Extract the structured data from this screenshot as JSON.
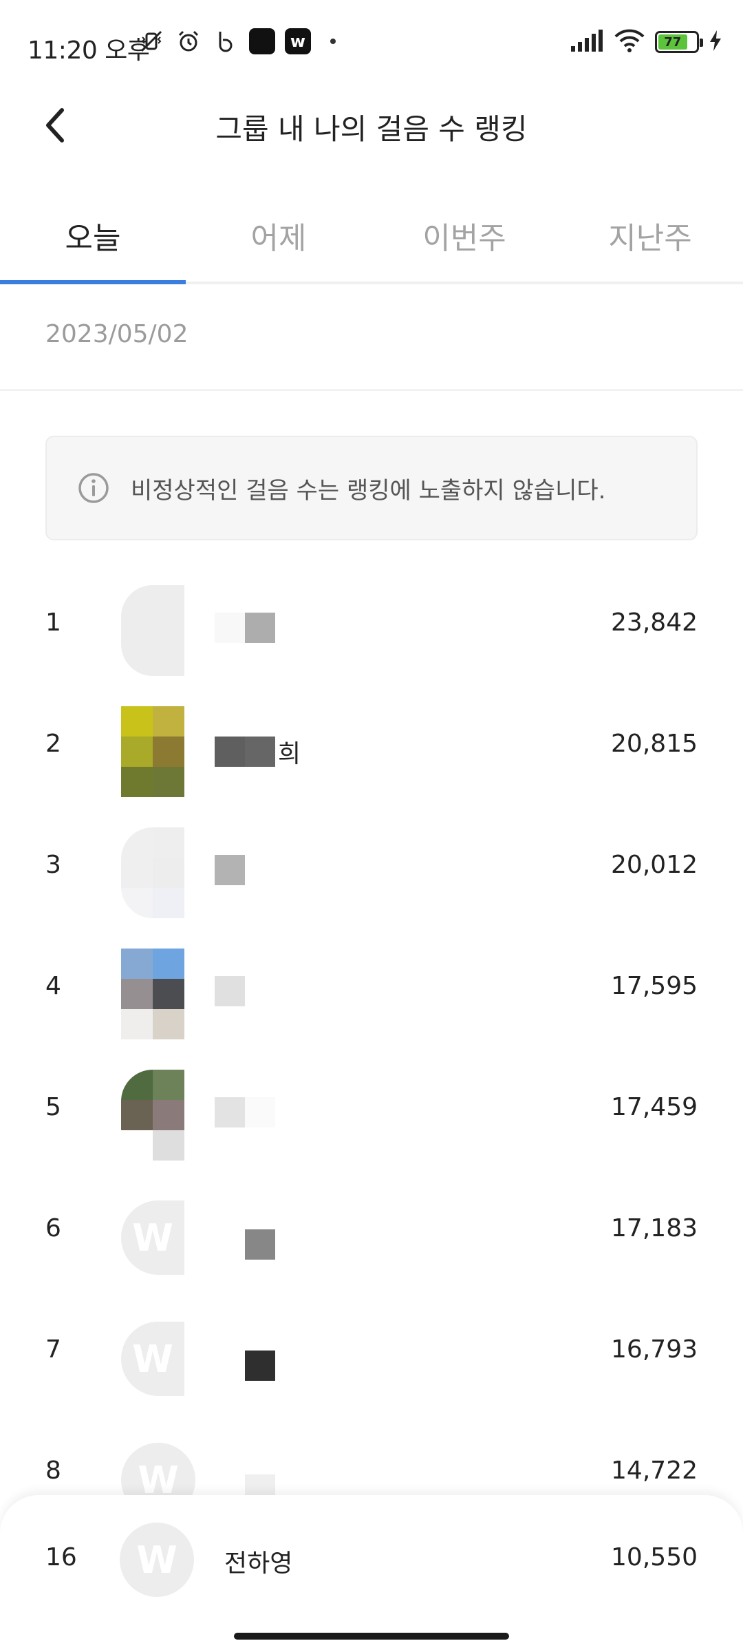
{
  "status_bar": {
    "time": "11:20 오후",
    "icons_left": [
      "mute-vibrate-icon",
      "alarm-icon",
      "b-app-icon",
      "black-square-app-icon",
      "w-app-icon"
    ],
    "icons_right": [
      "signal-icon",
      "wifi-icon",
      "battery-icon",
      "charging-icon"
    ],
    "battery_level": "77",
    "battery_color": "#5cc43a"
  },
  "header": {
    "title": "그룹 내 나의 걸음 수 랭킹"
  },
  "tabs": [
    {
      "label": "오늘",
      "active": true
    },
    {
      "label": "어제",
      "active": false
    },
    {
      "label": "이번주",
      "active": false
    },
    {
      "label": "지난주",
      "active": false
    }
  ],
  "accent_color": "#3a7ee0",
  "date": "2023/05/02",
  "notice": {
    "text": "비정상적인 걸음 수는 랭킹에 노출하지 않습니다."
  },
  "ranking": [
    {
      "rank": "1",
      "name_visible": "",
      "value": "23,842"
    },
    {
      "rank": "2",
      "name_visible": "희",
      "value": "20,815"
    },
    {
      "rank": "3",
      "name_visible": "",
      "value": "20,012"
    },
    {
      "rank": "4",
      "name_visible": "",
      "value": "17,595"
    },
    {
      "rank": "5",
      "name_visible": "",
      "value": "17,459"
    },
    {
      "rank": "6",
      "name_visible": "",
      "value": "17,183"
    },
    {
      "rank": "7",
      "name_visible": "",
      "value": "16,793"
    },
    {
      "rank": "8",
      "name_visible": "",
      "value": "14,722"
    }
  ],
  "my_rank": {
    "rank": "16",
    "avatar_letter": "W",
    "name": "전하영",
    "value": "10,550"
  }
}
